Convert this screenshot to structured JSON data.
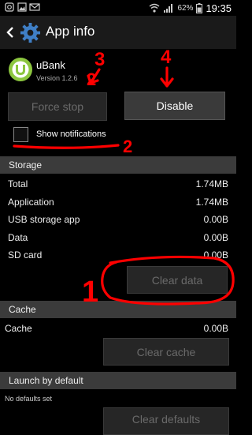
{
  "status_bar": {
    "battery_percent": "62%",
    "time": "19:35",
    "icons": [
      "instagram-icon",
      "gallery-icon",
      "email-icon",
      "wifi-icon",
      "signal-icon",
      "battery-icon"
    ]
  },
  "action_bar": {
    "title": "App info",
    "back_icon": "chevron-left-icon",
    "app_icon": "settings-gear-icon"
  },
  "app": {
    "name": "uBank",
    "version": "Version 1.2.6",
    "icon": "ubank-icon"
  },
  "buttons": {
    "force_stop": "Force stop",
    "disable": "Disable",
    "clear_data": "Clear data",
    "clear_cache": "Clear cache",
    "clear_defaults": "Clear defaults"
  },
  "show_notifications": {
    "label": "Show notifications",
    "checked": false
  },
  "storage": {
    "header": "Storage",
    "rows": [
      {
        "label": "Total",
        "value": "1.74MB"
      },
      {
        "label": "Application",
        "value": "1.74MB"
      },
      {
        "label": "USB storage app",
        "value": "0.00B"
      },
      {
        "label": "Data",
        "value": "0.00B"
      },
      {
        "label": "SD card",
        "value": "0.00B"
      }
    ]
  },
  "cache": {
    "header": "Cache",
    "rows": [
      {
        "label": "Cache",
        "value": "0.00B"
      }
    ]
  },
  "launch_default": {
    "header": "Launch by default",
    "text": "No defaults set"
  },
  "annotations": {
    "numbers": [
      "1",
      "2",
      "2",
      "3",
      "4"
    ],
    "color": "#ff0000"
  },
  "colors": {
    "background": "#000000",
    "section_header": "#3b3b3b",
    "button_disabled": "#262626",
    "button_enabled": "#3a3a3a",
    "annotation_red": "#ff0000"
  }
}
